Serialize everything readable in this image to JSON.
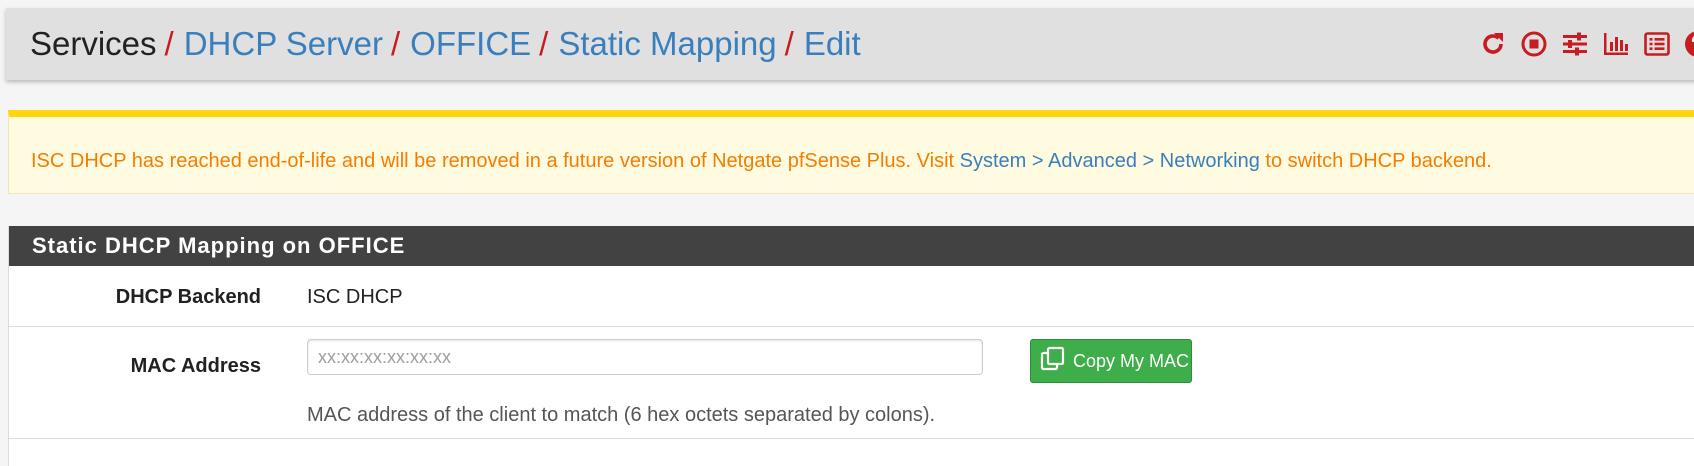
{
  "breadcrumb": {
    "root": "Services",
    "separator": "/",
    "items": [
      "DHCP Server",
      "OFFICE",
      "Static Mapping",
      "Edit"
    ]
  },
  "header_icons": [
    "restart-service-icon",
    "stop-service-icon",
    "settings-sliders-icon",
    "status-chart-icon",
    "log-list-icon",
    "help-icon"
  ],
  "alert": {
    "prefix": "ISC DHCP has reached end-of-life and will be removed in a future version of Netgate pfSense Plus. Visit ",
    "link_system": "System",
    "gt1": " > ",
    "link_advanced": "Advanced",
    "gt2": " > ",
    "link_networking": "Networking",
    "suffix": " to switch DHCP backend."
  },
  "panel": {
    "title": "Static DHCP Mapping on OFFICE",
    "dhcp_backend_label": "DHCP Backend",
    "dhcp_backend_value": "ISC DHCP",
    "mac_label": "MAC Address",
    "mac_value": "",
    "mac_placeholder": "xx:xx:xx:xx:xx:xx",
    "copy_button": "Copy My MAC",
    "mac_help": "MAC address of the client to match (6 hex octets separated by colons)."
  },
  "colors": {
    "accent_red": "#c71c22",
    "link_blue": "#3a7fbd",
    "warning_orange": "#f57c00",
    "warning_border": "#ffd60a",
    "success_green": "#3dae49",
    "panel_heading": "#424242"
  }
}
